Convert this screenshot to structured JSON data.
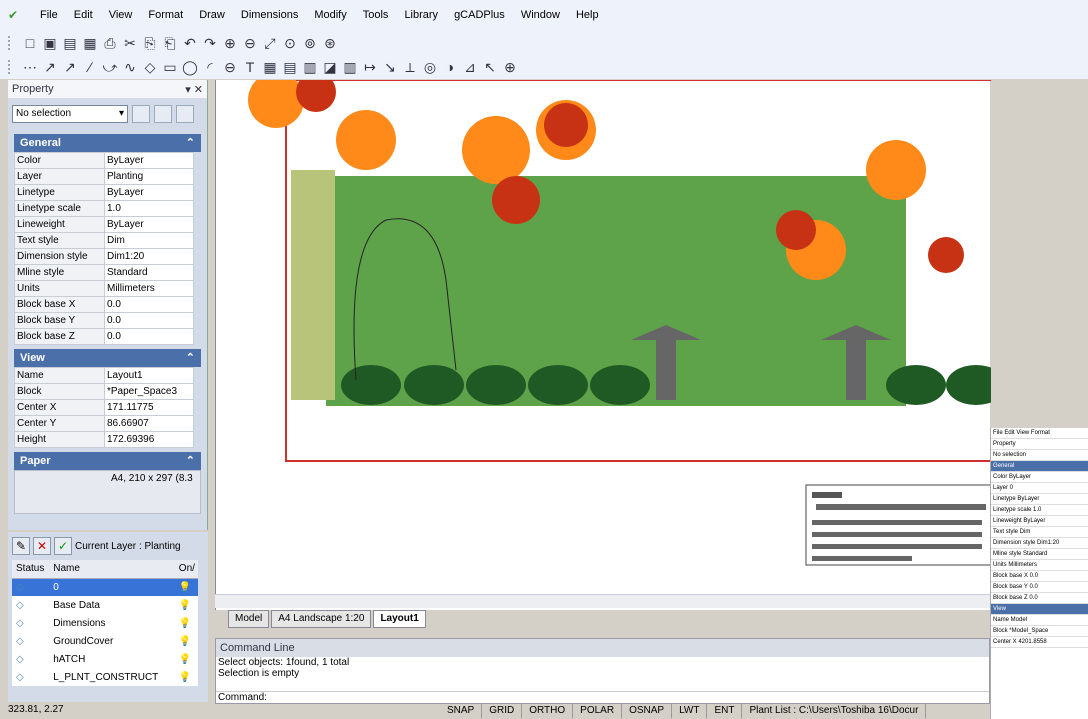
{
  "menu": [
    "File",
    "Edit",
    "View",
    "Format",
    "Draw",
    "Dimensions",
    "Modify",
    "Tools",
    "Library",
    "gCADPlus",
    "Window",
    "Help"
  ],
  "property_panel": {
    "title": "Property",
    "selection": "No selection",
    "general_header": "General",
    "general": [
      [
        "Color",
        "ByLayer"
      ],
      [
        "Layer",
        "Planting"
      ],
      [
        "Linetype",
        "ByLayer"
      ],
      [
        "Linetype scale",
        "1.0"
      ],
      [
        "Lineweight",
        "ByLayer"
      ],
      [
        "Text style",
        "Dim"
      ],
      [
        "Dimension style",
        "Dim1:20"
      ],
      [
        "Mline style",
        "Standard"
      ],
      [
        "Units",
        "Millimeters"
      ],
      [
        "Block base X",
        "0.0"
      ],
      [
        "Block base Y",
        "0.0"
      ],
      [
        "Block base Z",
        "0.0"
      ]
    ],
    "view_header": "View",
    "view": [
      [
        "Name",
        "Layout1"
      ],
      [
        "Block",
        "*Paper_Space3"
      ],
      [
        "Center X",
        "171.11775"
      ],
      [
        "Center Y",
        "86.66907"
      ],
      [
        "Height",
        "172.69396"
      ]
    ],
    "paper_header": "Paper",
    "paper_value": "A4, 210 x 297 (8.3"
  },
  "layers": {
    "current": "Current Layer : Planting",
    "headers": [
      "Status",
      "Name",
      "On/"
    ],
    "rows": [
      "0",
      "Base Data",
      "Dimensions",
      "GroundCover",
      "hATCH",
      "L_PLNT_CONSTRUCT"
    ]
  },
  "tabs": [
    "Model",
    "A4 Landscape 1:20",
    "Layout1"
  ],
  "command": {
    "title": "Command Line",
    "lines": [
      "Select objects: 1found,  1 total",
      "Selection is empty"
    ],
    "prompt": "Command:"
  },
  "coords": "323.81,  2.27",
  "status": [
    "SNAP",
    "GRID",
    "ORTHO",
    "POLAR",
    "OSNAP",
    "LWT",
    "ENT",
    "Plant List : C:\\Users\\Toshiba 16\\Docur"
  ],
  "mini_window": {
    "menu": [
      "File",
      "Edit",
      "View",
      "Format"
    ],
    "property": "Property",
    "selection": "No selection",
    "general": "General",
    "rows": [
      [
        "Color",
        "ByLayer"
      ],
      [
        "Layer",
        "0"
      ],
      [
        "Linetype",
        "ByLayer"
      ],
      [
        "Linetype scale",
        "1.0"
      ],
      [
        "Lineweight",
        "ByLayer"
      ],
      [
        "Text style",
        "Dim"
      ],
      [
        "Dimension style",
        "Dim1:20"
      ],
      [
        "Mline style",
        "Standard"
      ],
      [
        "Units",
        "Millimeters"
      ],
      [
        "Block base X",
        "0.0"
      ],
      [
        "Block base Y",
        "0.0"
      ],
      [
        "Block base Z",
        "0.0"
      ]
    ],
    "view": "View",
    "view_rows": [
      [
        "Name",
        "Model"
      ],
      [
        "Block",
        "*Model_Space"
      ],
      [
        "Center X",
        "4201.8558"
      ]
    ]
  }
}
